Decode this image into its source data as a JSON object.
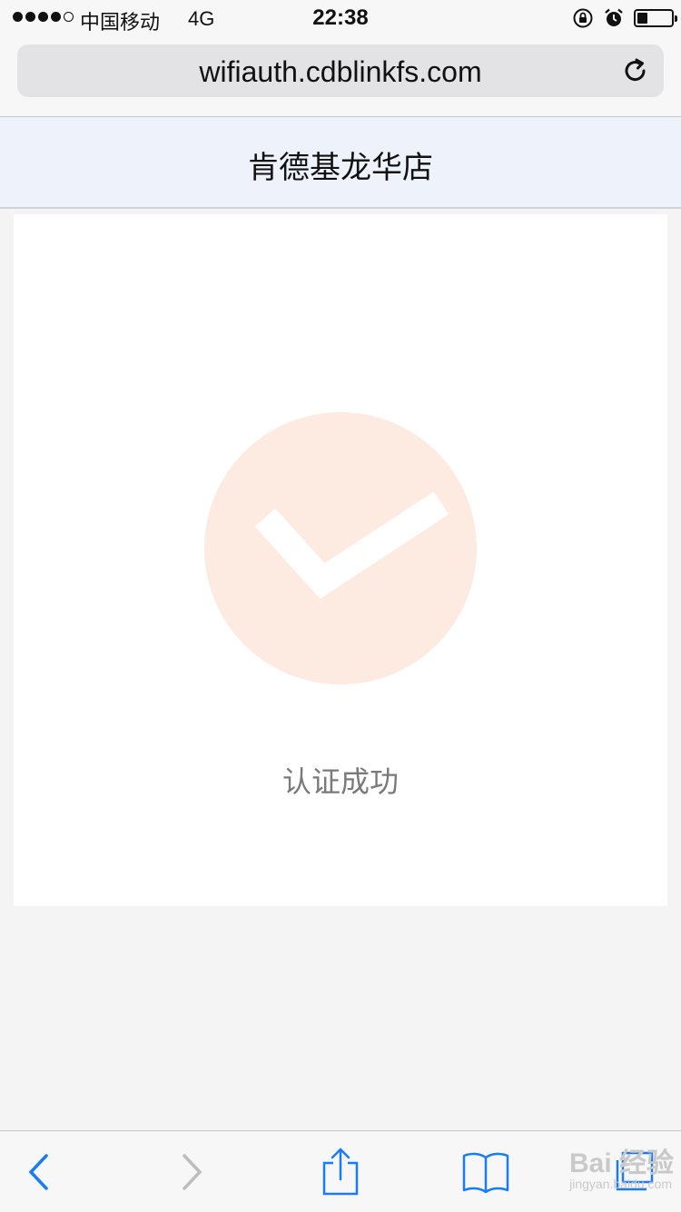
{
  "status_bar": {
    "signal_dots_filled": 4,
    "signal_dots_total": 5,
    "carrier": "中国移动",
    "network": "4G",
    "time": "22:38",
    "battery_level": 0.3
  },
  "browser": {
    "url": "wifiauth.cdblinkfs.com"
  },
  "page": {
    "title": "肯德基龙华店",
    "status_text": "认证成功",
    "check_circle_color": "#fdeae1",
    "check_color": "#ffffff"
  },
  "toolbar": {
    "accent_color": "#1a7cf5",
    "disabled_color": "#bdbdbd"
  },
  "watermark": {
    "text": "Bai 经验",
    "sub": "jingyan.baidu.com"
  }
}
